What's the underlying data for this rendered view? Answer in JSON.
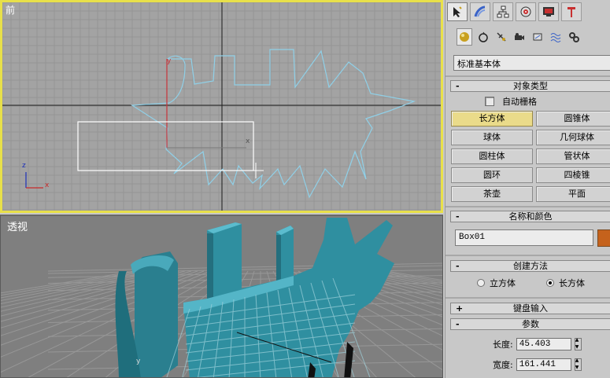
{
  "viewports": {
    "front_label": "前",
    "persp_label": "透视",
    "axis_x": "x",
    "axis_z": "z",
    "axis_y": "y"
  },
  "command_panel": {
    "tabs": [
      {
        "icon": "cursor-create-icon",
        "active": true
      },
      {
        "icon": "modify-icon"
      },
      {
        "icon": "hierarchy-icon"
      },
      {
        "icon": "motion-icon"
      },
      {
        "icon": "display-icon"
      },
      {
        "icon": "utilities-icon"
      }
    ],
    "subtabs": [
      {
        "icon": "geometry-icon",
        "active": true
      },
      {
        "icon": "shapes-icon"
      },
      {
        "icon": "lights-icon"
      },
      {
        "icon": "cameras-icon"
      },
      {
        "icon": "helpers-icon"
      },
      {
        "icon": "spacewarps-icon"
      },
      {
        "icon": "systems-icon"
      }
    ],
    "category_dropdown": "标准基本体",
    "object_type": {
      "title": "对象类型",
      "toggle": "-",
      "autogrid_label": "自动栅格",
      "buttons": [
        "长方体",
        "圆锥体",
        "球体",
        "几何球体",
        "圆柱体",
        "管状体",
        "圆环",
        "四棱锥",
        "茶壶",
        "平面"
      ],
      "active_button": "长方体"
    },
    "name_color": {
      "title": "名称和颜色",
      "toggle": "-",
      "name_value": "Box01",
      "color": "#c5621c"
    },
    "creation_method": {
      "title": "创建方法",
      "toggle": "-",
      "option_cube": "立方体",
      "option_box": "长方体",
      "selected": "长方体"
    },
    "keyboard_entry": {
      "title": "键盘输入",
      "toggle": "+"
    },
    "parameters": {
      "title": "参数",
      "toggle": "-",
      "length_label": "长度:",
      "length_value": "45.403",
      "width_label": "宽度:",
      "width_value": "161.441"
    }
  },
  "colors": {
    "active_viewport_border": "#e8e04a",
    "teal_object": "#2f8fa0",
    "spline": "#8fd0e8"
  }
}
